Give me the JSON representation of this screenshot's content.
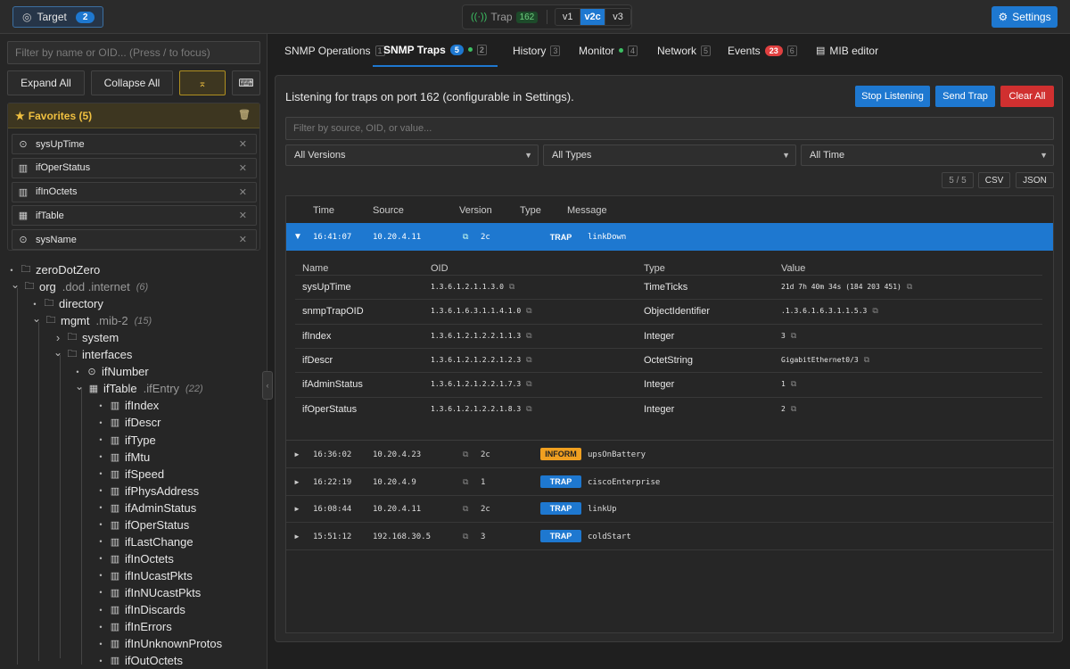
{
  "topbar": {
    "target_label": "Target",
    "target_count": "2",
    "trap_label": "Trap",
    "trap_count": "162",
    "versions": [
      "v1",
      "v2c",
      "v3"
    ],
    "active_version": "v2c",
    "settings_label": "Settings"
  },
  "sidebar": {
    "filter_placeholder": "Filter by name or OID... (Press / to focus)",
    "expand_all": "Expand All",
    "collapse_all": "Collapse All",
    "favorites": {
      "title": "Favorites (5)",
      "items": [
        {
          "label": "sysUpTime",
          "icon": "scalar-icon"
        },
        {
          "label": "ifOperStatus",
          "icon": "column-icon"
        },
        {
          "label": "ifInOctets",
          "icon": "column-icon"
        },
        {
          "label": "ifTable",
          "icon": "table-icon"
        },
        {
          "label": "sysName",
          "icon": "scalar-icon"
        }
      ]
    },
    "tree": [
      {
        "label": "zeroDotZero",
        "suffix": "",
        "count": "",
        "icon": "folder-icon",
        "level": 0,
        "toggle": "bullet"
      },
      {
        "label": "org",
        "suffix": ".dod .internet",
        "count": "(6)",
        "icon": "folder-icon",
        "level": 0,
        "toggle": "open"
      },
      {
        "label": "directory",
        "suffix": "",
        "count": "",
        "icon": "folder-icon",
        "level": 1,
        "toggle": "bullet"
      },
      {
        "label": "mgmt",
        "suffix": ".mib-2",
        "count": "(15)",
        "icon": "folder-icon",
        "level": 1,
        "toggle": "open"
      },
      {
        "label": "system",
        "suffix": "",
        "count": "",
        "icon": "folder-icon",
        "level": 2,
        "toggle": "closed"
      },
      {
        "label": "interfaces",
        "suffix": "",
        "count": "",
        "icon": "folder-icon",
        "level": 2,
        "toggle": "open"
      },
      {
        "label": "ifNumber",
        "suffix": "",
        "count": "",
        "icon": "scalar-icon",
        "level": 3,
        "toggle": "bullet"
      },
      {
        "label": "ifTable",
        "suffix": ".ifEntry",
        "count": "(22)",
        "icon": "table-icon",
        "level": 3,
        "toggle": "open"
      },
      {
        "label": "ifIndex",
        "suffix": "",
        "count": "",
        "icon": "column-icon",
        "level": 4,
        "toggle": "bullet"
      },
      {
        "label": "ifDescr",
        "suffix": "",
        "count": "",
        "icon": "column-icon",
        "level": 4,
        "toggle": "bullet"
      },
      {
        "label": "ifType",
        "suffix": "",
        "count": "",
        "icon": "column-icon",
        "level": 4,
        "toggle": "bullet"
      },
      {
        "label": "ifMtu",
        "suffix": "",
        "count": "",
        "icon": "column-icon",
        "level": 4,
        "toggle": "bullet"
      },
      {
        "label": "ifSpeed",
        "suffix": "",
        "count": "",
        "icon": "column-icon",
        "level": 4,
        "toggle": "bullet"
      },
      {
        "label": "ifPhysAddress",
        "suffix": "",
        "count": "",
        "icon": "column-icon",
        "level": 4,
        "toggle": "bullet"
      },
      {
        "label": "ifAdminStatus",
        "suffix": "",
        "count": "",
        "icon": "column-icon",
        "level": 4,
        "toggle": "bullet"
      },
      {
        "label": "ifOperStatus",
        "suffix": "",
        "count": "",
        "icon": "column-icon",
        "level": 4,
        "toggle": "bullet"
      },
      {
        "label": "ifLastChange",
        "suffix": "",
        "count": "",
        "icon": "column-icon",
        "level": 4,
        "toggle": "bullet"
      },
      {
        "label": "ifInOctets",
        "suffix": "",
        "count": "",
        "icon": "column-icon",
        "level": 4,
        "toggle": "bullet"
      },
      {
        "label": "ifInUcastPkts",
        "suffix": "",
        "count": "",
        "icon": "column-icon",
        "level": 4,
        "toggle": "bullet"
      },
      {
        "label": "ifInNUcastPkts",
        "suffix": "",
        "count": "",
        "icon": "column-icon",
        "level": 4,
        "toggle": "bullet"
      },
      {
        "label": "ifInDiscards",
        "suffix": "",
        "count": "",
        "icon": "column-icon",
        "level": 4,
        "toggle": "bullet"
      },
      {
        "label": "ifInErrors",
        "suffix": "",
        "count": "",
        "icon": "column-icon",
        "level": 4,
        "toggle": "bullet"
      },
      {
        "label": "ifInUnknownProtos",
        "suffix": "",
        "count": "",
        "icon": "column-icon",
        "level": 4,
        "toggle": "bullet"
      },
      {
        "label": "ifOutOctets",
        "suffix": "",
        "count": "",
        "icon": "column-icon",
        "level": 4,
        "toggle": "bullet"
      }
    ]
  },
  "tabs": [
    {
      "label": "SNMP Operations",
      "key": "1",
      "badge": "",
      "dot": false
    },
    {
      "label": "SNMP Traps",
      "key": "2",
      "badge": "5",
      "dot": true
    },
    {
      "label": "History",
      "key": "3",
      "badge": "",
      "dot": false
    },
    {
      "label": "Monitor",
      "key": "4",
      "badge": "",
      "dot": true
    },
    {
      "label": "Network",
      "key": "5",
      "badge": "",
      "dot": false
    },
    {
      "label": "Events",
      "key": "6",
      "badge": "23",
      "dot": false
    },
    {
      "label": "MIB editor",
      "key": "",
      "badge": "",
      "dot": false
    }
  ],
  "active_tab": "SNMP Traps",
  "traps": {
    "listening_text": "Listening for traps on port 162 (configurable in Settings).",
    "stop_label": "Stop Listening",
    "send_label": "Send Trap",
    "clear_label": "Clear All",
    "filter_placeholder": "Filter by source, OID, or value...",
    "version_select": "All Versions",
    "type_select": "All Types",
    "time_select": "All Time",
    "count_label": "5 / 5",
    "csv_label": "CSV",
    "json_label": "JSON",
    "columns": [
      "Time",
      "Source",
      "Version",
      "Type",
      "Message"
    ],
    "rows": [
      {
        "time": "16:41:07",
        "source": "10.20.4.11",
        "version": "2c",
        "type": "TRAP",
        "message": "linkDown",
        "expanded": true
      },
      {
        "time": "16:36:02",
        "source": "10.20.4.23",
        "version": "2c",
        "type": "INFORM",
        "message": "upsOnBattery",
        "expanded": false
      },
      {
        "time": "16:22:19",
        "source": "10.20.4.9",
        "version": "1",
        "type": "TRAP",
        "message": "ciscoEnterprise",
        "expanded": false
      },
      {
        "time": "16:08:44",
        "source": "10.20.4.11",
        "version": "2c",
        "type": "TRAP",
        "message": "linkUp",
        "expanded": false
      },
      {
        "time": "15:51:12",
        "source": "192.168.30.5",
        "version": "3",
        "type": "TRAP",
        "message": "coldStart",
        "expanded": false
      }
    ],
    "detail_columns": [
      "Name",
      "OID",
      "Type",
      "Value"
    ],
    "detail_rows": [
      {
        "name": "sysUpTime",
        "oid": "1.3.6.1.2.1.1.3.0",
        "type": "TimeTicks",
        "value": "21d 7h 40m 34s (184 203 451)"
      },
      {
        "name": "snmpTrapOID",
        "oid": "1.3.6.1.6.3.1.1.4.1.0",
        "type": "ObjectIdentifier",
        "value": ".1.3.6.1.6.3.1.1.5.3"
      },
      {
        "name": "ifIndex",
        "oid": "1.3.6.1.2.1.2.2.1.1.3",
        "type": "Integer",
        "value": "3"
      },
      {
        "name": "ifDescr",
        "oid": "1.3.6.1.2.1.2.2.1.2.3",
        "type": "OctetString",
        "value": "GigabitEthernet0/3"
      },
      {
        "name": "ifAdminStatus",
        "oid": "1.3.6.1.2.1.2.2.1.7.3",
        "type": "Integer",
        "value": "1"
      },
      {
        "name": "ifOperStatus",
        "oid": "1.3.6.1.2.1.2.2.1.8.3",
        "type": "Integer",
        "value": "2"
      }
    ]
  },
  "colors": {
    "accent": "#1e78d0",
    "danger": "#d03030",
    "warning": "#f0a020",
    "favorite": "#f0c040"
  }
}
